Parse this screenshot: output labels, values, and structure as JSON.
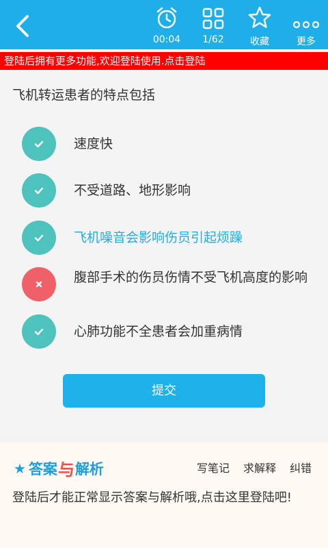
{
  "toolbar": {
    "timer": "00:04",
    "progress": "1/62",
    "favorite_label": "收藏",
    "more_label": "更多"
  },
  "banner": "登陆后拥有更多功能,欢迎登陆使用.点击登陆",
  "question": "飞机转运患者的特点包括",
  "options": [
    {
      "text": "速度快",
      "status": "correct",
      "color": "#333333"
    },
    {
      "text": "不受道路、地形影响",
      "status": "correct",
      "color": "#333333"
    },
    {
      "text": "飞机噪音会影响伤员引起烦躁",
      "status": "correct",
      "color": "#1eaee9"
    },
    {
      "text": "腹部手术的伤员伤情不受飞机高度的影响",
      "status": "wrong",
      "color": "#333333"
    },
    {
      "text": "心肺功能不全患者会加重病情",
      "status": "correct",
      "color": "#333333"
    }
  ],
  "submit_label": "提交",
  "analysis": {
    "title_left": "答案",
    "title_mid": "与",
    "title_right": "解析",
    "actions": [
      "写笔记",
      "求解释",
      "纠错"
    ],
    "hint": "登陆后才能正常显示答案与解析哦,点击这里登陆吧!"
  },
  "colors": {
    "accent": "#1eaee9",
    "correct": "#4ec2bd",
    "wrong": "#ef6069",
    "banner": "#ff0000"
  }
}
